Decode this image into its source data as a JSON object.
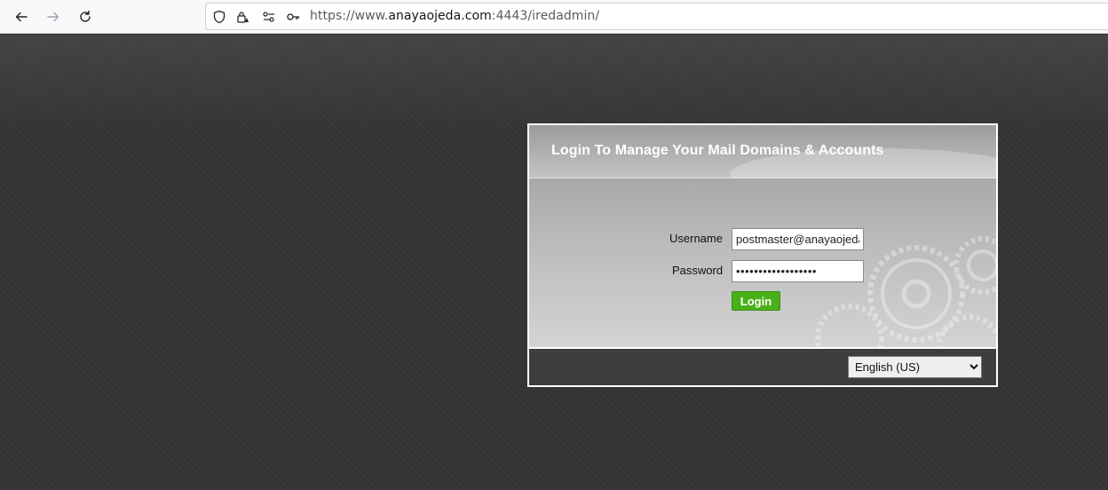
{
  "browser": {
    "url_prefix": "https://www.",
    "url_host": "anayaojeda.com",
    "url_suffix": ":4443/iredadmin/"
  },
  "login": {
    "title": "Login To Manage Your Mail Domains & Accounts",
    "username_label": "Username",
    "username_value": "postmaster@anayaojeda.com",
    "password_label": "Password",
    "password_value": "••••••••••••••••••",
    "submit_label": "Login"
  },
  "footer": {
    "language_selected": "English (US)"
  },
  "colors": {
    "page_background": "#333333",
    "login_button": "#4ab019",
    "title_text": "#ffffff"
  }
}
